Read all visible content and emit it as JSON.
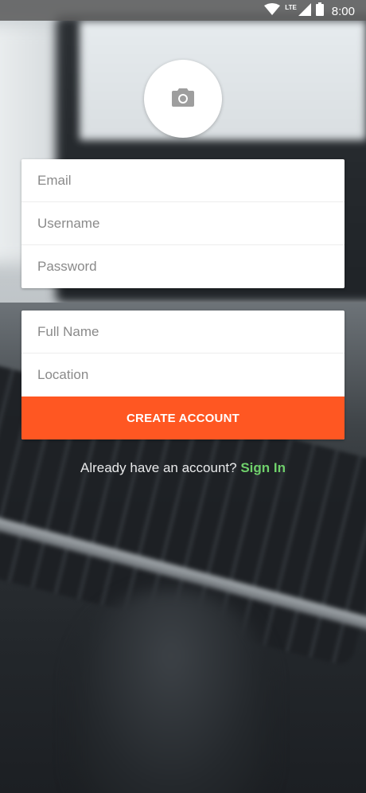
{
  "status_bar": {
    "time": "8:00",
    "network_label": "LTE",
    "icons": [
      "wifi-icon",
      "cell-signal-icon",
      "battery-icon"
    ]
  },
  "avatar": {
    "icon": "camera-icon"
  },
  "account_fields": {
    "email_placeholder": "Email",
    "username_placeholder": "Username",
    "password_placeholder": "Password"
  },
  "profile_fields": {
    "full_name_placeholder": "Full Name",
    "location_placeholder": "Location"
  },
  "create_button": {
    "label": "CREATE ACCOUNT"
  },
  "signin": {
    "prompt": "Already have an account?",
    "link": "Sign In"
  },
  "colors": {
    "accent": "#ff5722",
    "link": "#6fd06b",
    "placeholder": "#8a8a8a"
  }
}
